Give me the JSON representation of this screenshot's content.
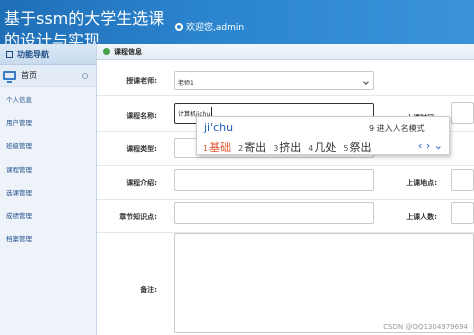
{
  "header": {
    "site_title": "基于ssm的大学生选课的设计与实现",
    "welcome": "欢迎您,admin"
  },
  "sidebar": {
    "title": "功能导航",
    "home_label": "首页",
    "items": [
      {
        "label": "个人信息"
      },
      {
        "label": "用户管理"
      },
      {
        "label": "班级管理"
      },
      {
        "label": "课程管理"
      },
      {
        "label": "选课管理"
      },
      {
        "label": "成绩管理"
      },
      {
        "label": "档案管理"
      }
    ]
  },
  "panel": {
    "title": "课程信息"
  },
  "form": {
    "teacher_label": "授课老师:",
    "teacher_value": "老师1",
    "course_name_label": "课程名称:",
    "course_name_value": "计算机jichu",
    "course_type_label": "课程类型:",
    "course_intro_label": "课程介绍:",
    "chapter_label": "章节知识点:",
    "remark_label": "备注:",
    "class_time_label": "上课时间:",
    "class_place_label": "上课地点:",
    "class_count_label": "上课人数:"
  },
  "ime": {
    "pinyin": "ji'chu",
    "mode_hint": "9 进入人名模式",
    "candidates": [
      {
        "num": "1",
        "text": "基础"
      },
      {
        "num": "2",
        "text": "寄出"
      },
      {
        "num": "3",
        "text": "挤出"
      },
      {
        "num": "4",
        "text": "几处"
      },
      {
        "num": "5",
        "text": "祭出"
      }
    ],
    "nav": "‹ › ⌄"
  },
  "watermark": "CSDN @QQ1304979694",
  "colors": {
    "header_bg": "#2b85cf",
    "sidebar_bg": "#eef3f9",
    "selected_candidate": "#e2552c"
  }
}
